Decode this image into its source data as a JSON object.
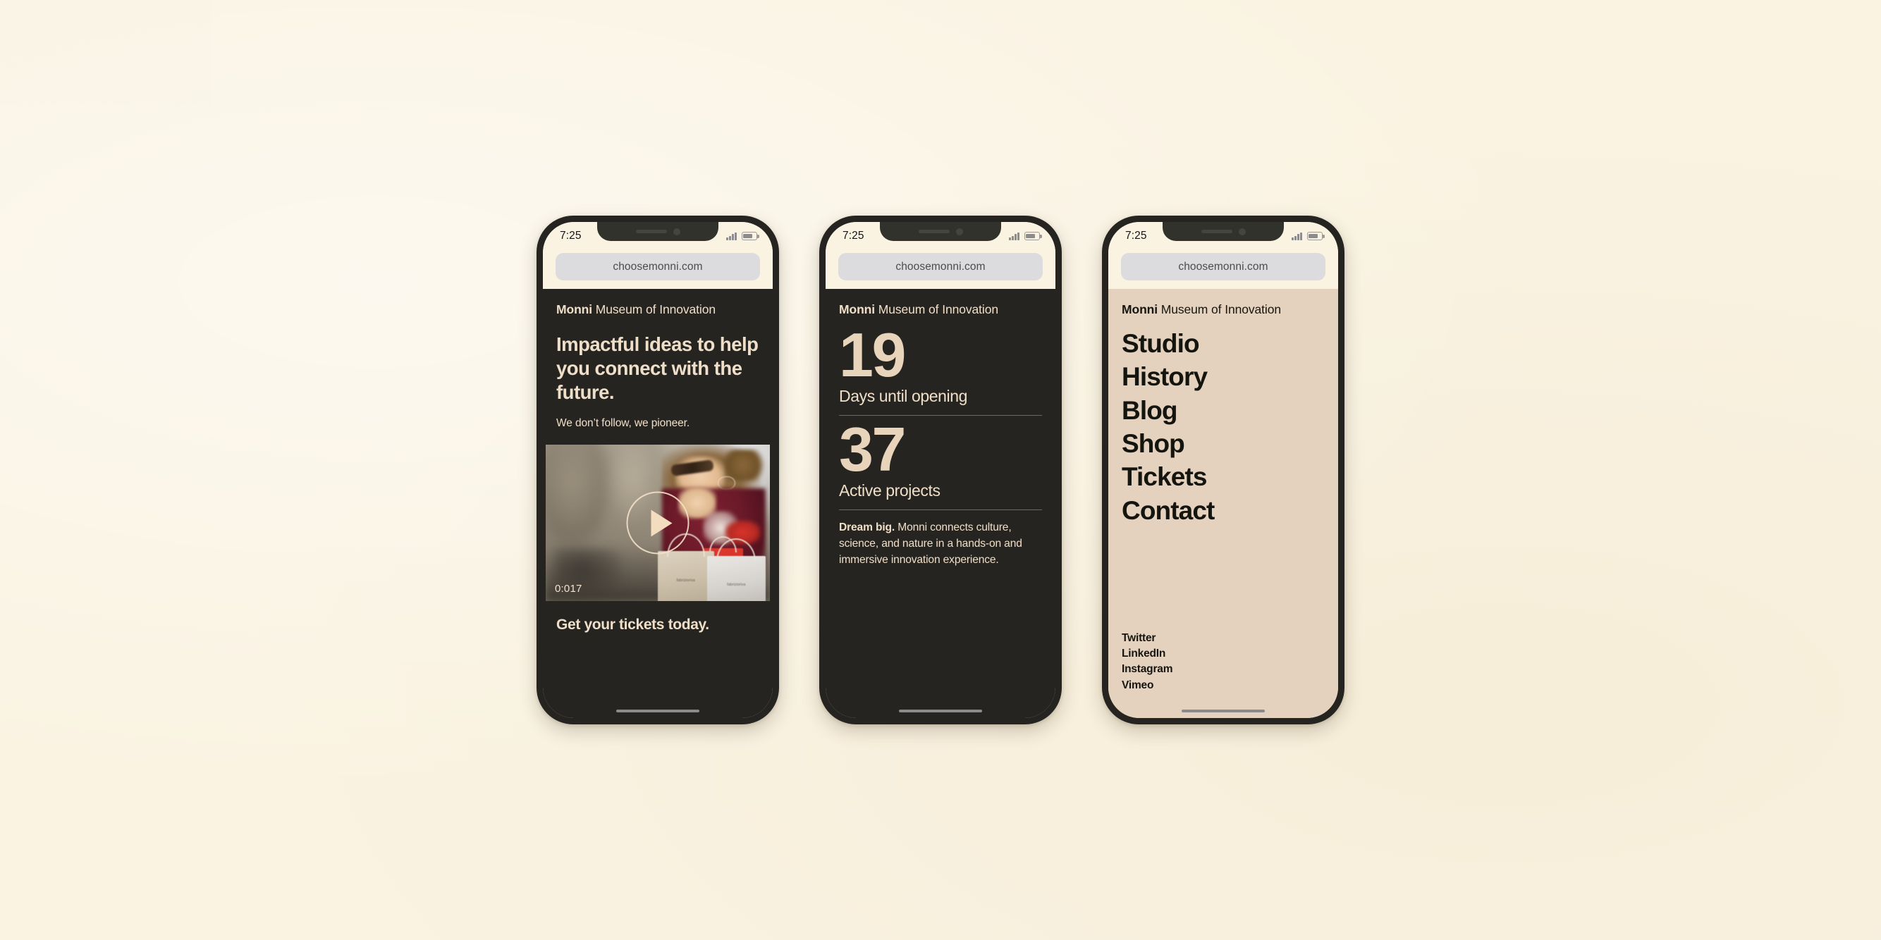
{
  "background_color": "#FAF3E2",
  "colors": {
    "cream": "#FAF3E2",
    "dark": "#262420",
    "beige": "#E5D2BE",
    "text_light": "#EFDFC9",
    "text_dark": "#15150F",
    "accent_number": "#E8D4BB"
  },
  "status_bar": {
    "time": "7:25",
    "signal_icon": "signal-bars-icon",
    "battery_icon": "battery-icon"
  },
  "browser": {
    "url": "choosemonni.com"
  },
  "brand": {
    "name": "Monni",
    "tagline": "Museum of Innovation"
  },
  "phones": [
    {
      "id": "phone-home",
      "theme": "dark",
      "headline": "Impactful ideas to help you connect with the future.",
      "subline": "We don’t follow, we pioneer.",
      "video": {
        "play_icon": "play-icon",
        "duration": "0:017",
        "bag_label": "fabrizioriva"
      },
      "cta": "Get your tickets today."
    },
    {
      "id": "phone-stats",
      "theme": "dark",
      "stats": [
        {
          "number": "19",
          "label": "Days until opening"
        },
        {
          "number": "37",
          "label": "Active projects"
        }
      ],
      "body_lead": "Dream big.",
      "body_rest": " Monni connects culture, science, and nature in a hands-on and immersive innovation experience."
    },
    {
      "id": "phone-menu",
      "theme": "beige",
      "menu": [
        "Studio",
        "History",
        "Blog",
        "Shop",
        "Tickets",
        "Contact"
      ],
      "social": [
        "Twitter",
        "LinkedIn",
        "Instagram",
        "Vimeo"
      ]
    }
  ]
}
